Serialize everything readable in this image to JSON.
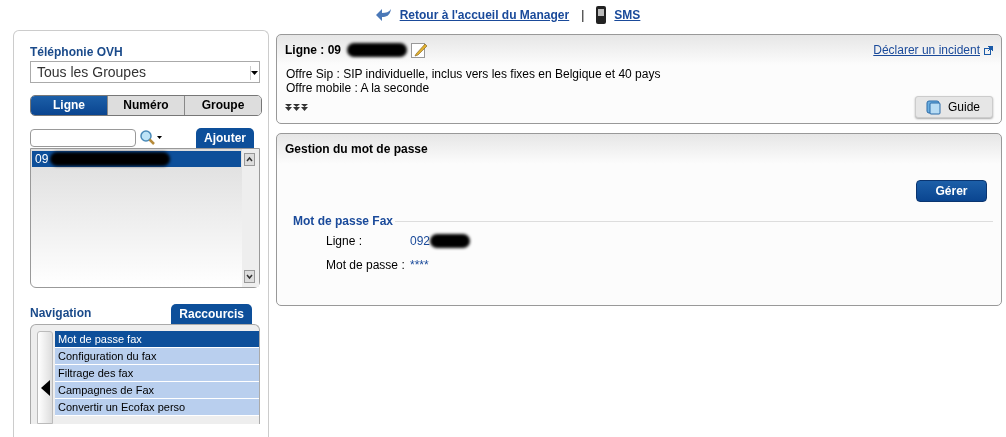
{
  "top_links": [
    {
      "kind": "back",
      "label": "Retour à l'accueil du Manager"
    },
    {
      "kind": "sms",
      "label": "SMS"
    }
  ],
  "top_separator": "|",
  "sidebar": {
    "title": "Téléphonie OVH",
    "group_select": {
      "value": "Tous les Groupes"
    },
    "tabs": [
      {
        "label": "Ligne",
        "selected": true
      },
      {
        "label": "Numéro",
        "selected": false
      },
      {
        "label": "Groupe",
        "selected": false
      }
    ],
    "add_button": "Ajouter",
    "lines": [
      {
        "label": "09",
        "selected": true
      }
    ],
    "navigation": {
      "title": "Navigation",
      "shortcuts_tab": "Raccourcis",
      "items": [
        {
          "label": "Mot de passe fax",
          "selected": true
        },
        {
          "label": "Configuration du fax",
          "selected": false
        },
        {
          "label": "Filtrage des fax",
          "selected": false
        },
        {
          "label": "Campagnes de Fax",
          "selected": false
        },
        {
          "label": "Convertir un Ecofax perso",
          "selected": false
        }
      ]
    }
  },
  "line_card": {
    "title": "Ligne : 09",
    "incident_link": "Déclarer un incident",
    "details": [
      "Offre Sip : SIP individuelle, inclus vers les fixes en Belgique et 40 pays",
      "Offre mobile : A la seconde"
    ],
    "guide_button": "Guide"
  },
  "password_card": {
    "title": "Gestion du mot de passe",
    "manage_button": "Gérer",
    "section_title": "Mot de passe Fax",
    "fields": [
      {
        "label": "Ligne :",
        "value": "092",
        "redacted": true
      },
      {
        "label": "Mot de passe :",
        "value": "****",
        "redacted": false
      }
    ]
  }
}
